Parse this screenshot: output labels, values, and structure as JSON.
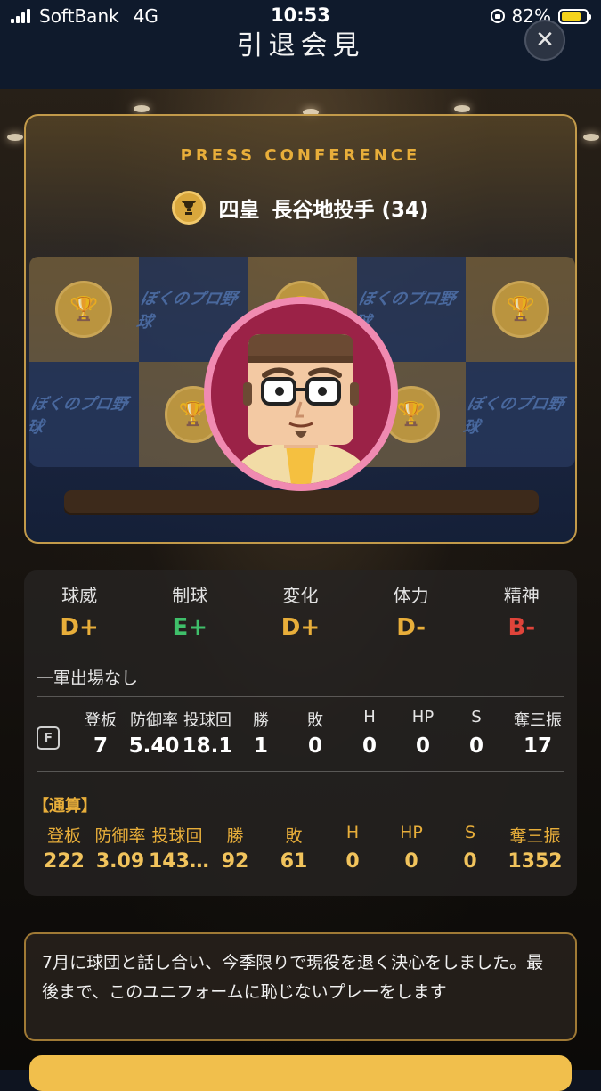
{
  "status_bar": {
    "carrier": "SoftBank",
    "network": "4G",
    "time": "10:53",
    "battery_percent": "82%",
    "battery_level": 0.82
  },
  "header": {
    "title": "引退会見",
    "close_icon": "close-icon"
  },
  "press": {
    "label": "PRESS CONFERENCE",
    "team": "四皇",
    "player": "長谷地投手 (34)",
    "trophy_icon": "trophy-icon",
    "logo_text": "ぼくのプロ野球"
  },
  "ratings": [
    {
      "label": "球威",
      "grade": "D+",
      "color": "#e8ae3a"
    },
    {
      "label": "制球",
      "grade": "E+",
      "color": "#3fbf6a"
    },
    {
      "label": "変化",
      "grade": "D+",
      "color": "#e8ae3a"
    },
    {
      "label": "体力",
      "grade": "D-",
      "color": "#e8ae3a"
    },
    {
      "label": "精神",
      "grade": "B-",
      "color": "#e0443a"
    }
  ],
  "note": "一軍出場なし",
  "season": {
    "team_badge": "F",
    "headers": [
      "登板",
      "防御率",
      "投球回",
      "勝",
      "敗",
      "H",
      "HP",
      "S",
      "奪三振"
    ],
    "values": [
      "7",
      "5.40",
      "18.1",
      "1",
      "0",
      "0",
      "0",
      "0",
      "17"
    ]
  },
  "career": {
    "title": "【通算】",
    "headers": [
      "登板",
      "防御率",
      "投球回",
      "勝",
      "敗",
      "H",
      "HP",
      "S",
      "奪三振"
    ],
    "values": [
      "222",
      "3.09",
      "143…",
      "92",
      "61",
      "0",
      "0",
      "0",
      "1352"
    ]
  },
  "comment": "7月に球団と話し合い、今季限りで現役を退く決心をしました。最後まで、このユニフォームに恥じないプレーをします"
}
